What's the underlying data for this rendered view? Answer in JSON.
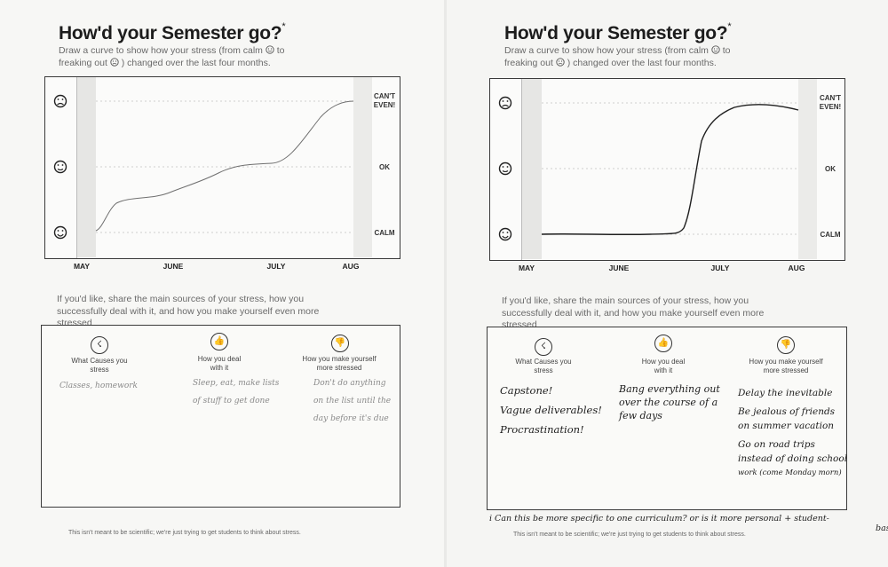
{
  "common": {
    "title": "How'd your Semester go?",
    "title_mark": "*",
    "instructions": [
      "Draw a curve to show how your stress (from calm",
      "to",
      "freaking out",
      ") changed over the last four months."
    ],
    "levels": {
      "top": [
        "CAN'T",
        "EVEN!"
      ],
      "middle": "OK",
      "bottom": "CALM"
    },
    "months": [
      "MAY",
      "JUNE",
      "JULY",
      "AUG"
    ],
    "prompt": "If you'd like, share the main sources of your stress, how you successfully deal with it, and how you make yourself even more stressed",
    "columns": [
      {
        "icon": "stress-icon",
        "heading": [
          "What Causes you",
          "stress"
        ]
      },
      {
        "icon": "thumbs-up-icon",
        "heading": [
          "How you deal",
          "with it"
        ]
      },
      {
        "icon": "thumbs-down-icon",
        "heading": [
          "How you make yourself",
          "more stressed"
        ]
      }
    ],
    "footer": "This isn't meant to be scientific; we're just trying to get students to think about stress."
  },
  "left_sheet": {
    "causes": [
      "Classes, homework"
    ],
    "deal": [
      "Sleep, eat, make lists",
      "of stuff to get done"
    ],
    "worse": [
      "Don't do anything",
      "on the list until the",
      "day before it's due"
    ]
  },
  "right_sheet": {
    "causes": [
      "Capstone!",
      "Vague deliverables!",
      "Procrastination!"
    ],
    "deal": [
      "Bang everything out",
      "over the course of a",
      "few days"
    ],
    "worse": [
      "Delay the inevitable",
      "Be jealous of friends",
      "on summer vacation",
      "Go on road trips",
      "instead of doing school",
      "work (come Monday morn)"
    ],
    "margin_note": [
      "i Can this be more specific to one curriculum? or is it more personal + student-",
      "based?"
    ]
  }
}
